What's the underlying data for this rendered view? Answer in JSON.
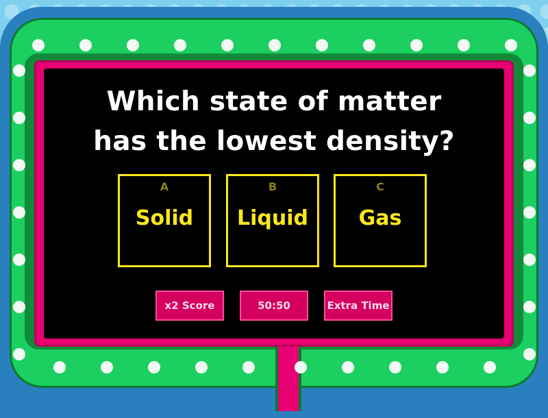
{
  "question": {
    "line1": "Which state of matter",
    "line2": "has the lowest density?"
  },
  "answers": [
    {
      "letter": "A",
      "label": "Solid"
    },
    {
      "letter": "B",
      "label": "Liquid"
    },
    {
      "letter": "C",
      "label": "Gas"
    }
  ],
  "powerups": {
    "double_score": "x2 Score",
    "fifty_fifty": "50:50",
    "extra_time": "Extra Time"
  },
  "colors": {
    "answer_accent": "#ffe81a",
    "powerup_bg": "#d4005f",
    "frame_green": "#1bd060",
    "frame_pink": "#e60073"
  }
}
